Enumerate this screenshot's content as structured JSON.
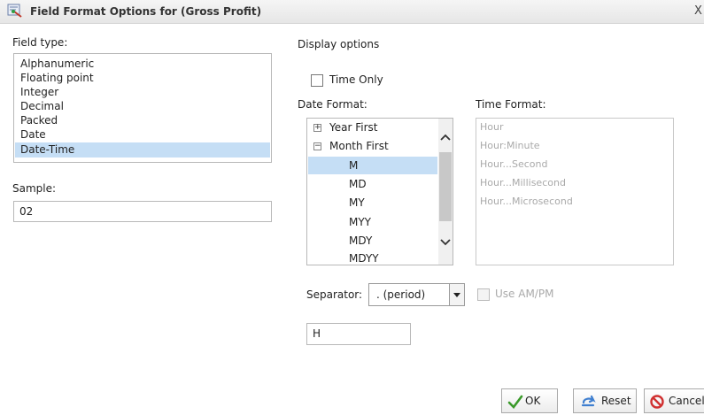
{
  "dialog": {
    "title": "Field Format Options for (Gross Profit)",
    "close_glyph": "X"
  },
  "field_type": {
    "label": "Field type:",
    "items": [
      "Alphanumeric",
      "Floating point",
      "Integer",
      "Decimal",
      "Packed",
      "Date",
      "Date-Time"
    ],
    "selected": "Date-Time"
  },
  "sample": {
    "label": "Sample:",
    "value": "02"
  },
  "display_options": {
    "label": "Display options",
    "time_only_label": "Time Only",
    "time_only_checked": false
  },
  "date_format": {
    "label": "Date Format:",
    "groups": [
      {
        "label": "Year First",
        "expanded": false,
        "toggle": "+"
      },
      {
        "label": "Month First",
        "expanded": true,
        "toggle": "−"
      }
    ],
    "items": [
      "M",
      "MD",
      "MY",
      "MYY",
      "MDY",
      "MDYY"
    ],
    "selected": "M"
  },
  "time_format": {
    "label": "Time Format:",
    "items": [
      "Hour",
      "Hour:Minute",
      "Hour...Second",
      "Hour...Millisecond",
      "Hour...Microsecond"
    ],
    "enabled": false
  },
  "separator": {
    "label": "Separator:",
    "value": ". (period)"
  },
  "use_ampm": {
    "label": "Use AM/PM",
    "enabled": false
  },
  "format_code": {
    "value": "H"
  },
  "buttons": {
    "ok": "OK",
    "reset": "Reset",
    "cancel": "Cancel"
  },
  "colors": {
    "selection": "#c5def5",
    "disabled_text": "#a9a9a9",
    "ok_check": "#3a9a2a",
    "reset_icon": "#3f7fd0",
    "cancel_icon": "#d03030"
  }
}
